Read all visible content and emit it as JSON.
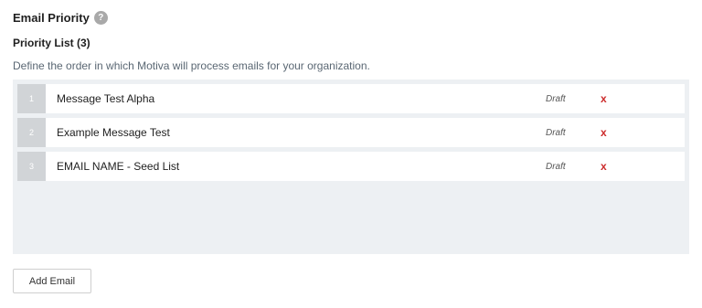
{
  "header": {
    "title": "Email Priority",
    "help_icon": "question-mark-icon",
    "help_glyph": "?"
  },
  "priority_list": {
    "title": "Priority List (3)",
    "description": "Define the order in which Motiva will process emails for your organization.",
    "items": [
      {
        "rank": "1",
        "name": "Message Test Alpha",
        "status": "Draft",
        "remove_glyph": "x"
      },
      {
        "rank": "2",
        "name": "Example Message Test",
        "status": "Draft",
        "remove_glyph": "x"
      },
      {
        "rank": "3",
        "name": "EMAIL NAME - Seed List",
        "status": "Draft",
        "remove_glyph": "x"
      }
    ]
  },
  "actions": {
    "add_email_label": "Add Email"
  },
  "colors": {
    "list_background": "#edf0f3",
    "rank_background": "#d1d4d7",
    "remove_color": "#cc2b2b",
    "description_color": "#5a6773"
  }
}
